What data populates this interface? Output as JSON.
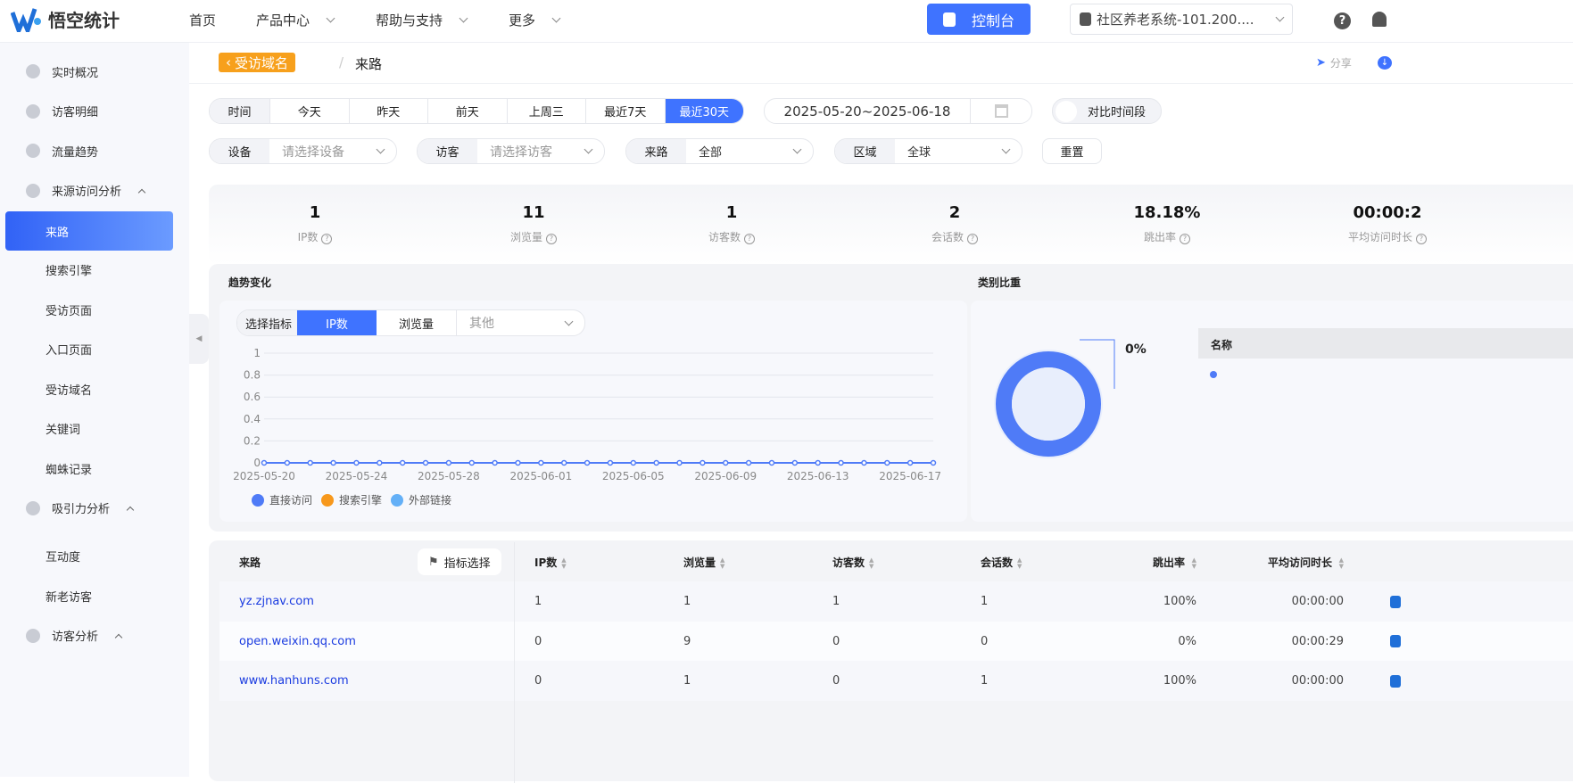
{
  "header": {
    "brand": "悟空统计",
    "nav": [
      {
        "label": "首页",
        "dropdown": false
      },
      {
        "label": "产品中心",
        "dropdown": true
      },
      {
        "label": "帮助与支持",
        "dropdown": true
      },
      {
        "label": "更多",
        "dropdown": true
      }
    ],
    "console": "控制台",
    "site": "社区养老系统-101.200...."
  },
  "sidebar": {
    "items": [
      {
        "label": "实时概况",
        "type": "top"
      },
      {
        "label": "访客明细",
        "type": "top"
      },
      {
        "label": "流量趋势",
        "type": "top"
      },
      {
        "label": "来源访问分析",
        "type": "group"
      },
      {
        "label": "来路",
        "type": "sub",
        "active": true
      },
      {
        "label": "搜索引擎",
        "type": "sub"
      },
      {
        "label": "受访页面",
        "type": "sub"
      },
      {
        "label": "入口页面",
        "type": "sub"
      },
      {
        "label": "受访域名",
        "type": "sub"
      },
      {
        "label": "关键词",
        "type": "sub"
      },
      {
        "label": "蜘蛛记录",
        "type": "sub"
      },
      {
        "label": "吸引力分析",
        "type": "group"
      },
      {
        "label": "互动度",
        "type": "sub"
      },
      {
        "label": "新老访客",
        "type": "sub"
      },
      {
        "label": "访客分析",
        "type": "group"
      }
    ]
  },
  "breadcrumb": {
    "back": "受访域名",
    "current": "来路",
    "share": "分享"
  },
  "filters": {
    "time_label": "时间",
    "time_options": [
      "今天",
      "昨天",
      "前天",
      "上周三",
      "最近7天",
      "最近30天"
    ],
    "time_selected": "最近30天",
    "date_range": "2025-05-20~2025-06-18",
    "compare": "对比时间段",
    "device_label": "设备",
    "device_placeholder": "请选择设备",
    "visitor_label": "访客",
    "visitor_placeholder": "请选择访客",
    "source_label": "来路",
    "source_value": "全部",
    "region_label": "区域",
    "region_value": "全球",
    "reset": "重置"
  },
  "kpis": [
    {
      "value": "1",
      "label": "IP数"
    },
    {
      "value": "11",
      "label": "浏览量"
    },
    {
      "value": "1",
      "label": "访客数"
    },
    {
      "value": "2",
      "label": "会话数"
    },
    {
      "value": "18.18%",
      "label": "跳出率"
    },
    {
      "value": "00:00:2",
      "label": "平均访问时长"
    }
  ],
  "trend": {
    "title": "趋势变化",
    "metric_label": "选择指标",
    "metrics": [
      "IP数",
      "浏览量"
    ],
    "other": "其他"
  },
  "pie": {
    "title": "类别比重",
    "label": "0%",
    "table_header": "名称"
  },
  "chart_data": {
    "type": "line",
    "title": "趋势变化",
    "ylim": [
      0,
      1
    ],
    "yticks": [
      "1",
      "0.8",
      "0.6",
      "0.4",
      "0.2",
      "0"
    ],
    "xticks": [
      "2025-05-20",
      "2025-05-24",
      "2025-05-28",
      "2025-06-01",
      "2025-06-05",
      "2025-06-09",
      "2025-06-13",
      "2025-06-17"
    ],
    "x_count": 30,
    "series": [
      {
        "name": "直接访问",
        "color": "#4f7bf7",
        "values": [
          0,
          0,
          0,
          0,
          0,
          0,
          0,
          0,
          0,
          0,
          0,
          0,
          0,
          0,
          0,
          0,
          0,
          0,
          0,
          0,
          0,
          0,
          0,
          0,
          0,
          0,
          0,
          0,
          0,
          0
        ]
      },
      {
        "name": "搜索引擎",
        "color": "#f7981c",
        "values": []
      },
      {
        "name": "外部链接",
        "color": "#64b0f7",
        "values": []
      }
    ]
  },
  "table": {
    "headers": [
      "来路",
      "IP数",
      "浏览量",
      "访客数",
      "会话数",
      "跳出率",
      "平均访问时长"
    ],
    "metric_select": "指标选择",
    "rows": [
      [
        "yz.zjnav.com",
        "1",
        "1",
        "1",
        "1",
        "100%",
        "00:00:00"
      ],
      [
        "open.weixin.qq.com",
        "0",
        "9",
        "0",
        "0",
        "0%",
        "00:00:29"
      ],
      [
        "www.hanhuns.com",
        "0",
        "1",
        "0",
        "1",
        "100%",
        "00:00:00"
      ]
    ]
  }
}
